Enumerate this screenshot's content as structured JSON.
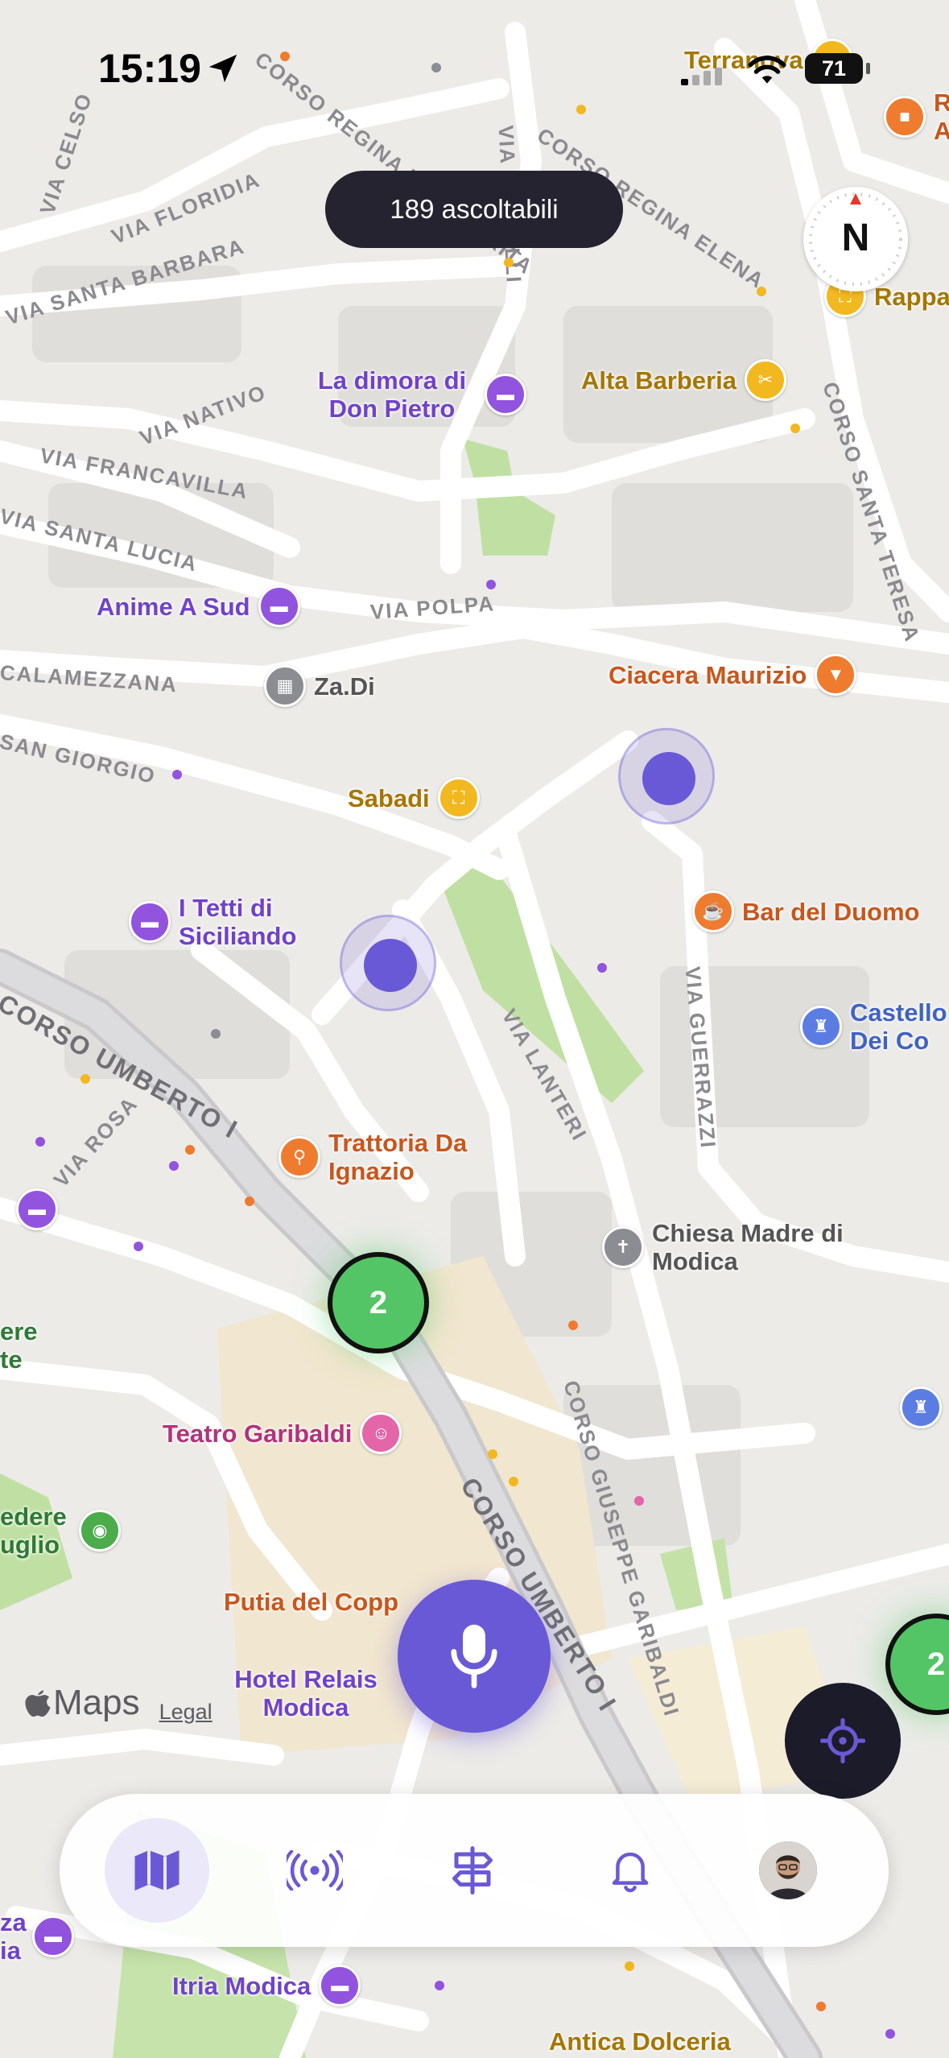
{
  "status_bar": {
    "time": "15:19",
    "battery": "71"
  },
  "listenable_pill": "189 ascoltabili",
  "compass_label": "N",
  "streets": [
    "Via Celso",
    "Via Floridia",
    "Via Santa Barbara",
    "Corso Regina Margherita",
    "Via Fratelli",
    "Corso Regina Elena",
    "Via Nativo",
    "Via Francavilla",
    "Via Santa Lucia",
    "Via Polpa",
    "Calamezzana",
    "San Giorgio",
    "Corso Santa Teresa",
    "Corso Umberto I",
    "Via Rosa",
    "Via Lanteri",
    "Via Guerrazzi",
    "Corso Giuseppe Garibaldi",
    "Corso Umberto I"
  ],
  "pois": [
    {
      "name": "Terranova",
      "kind": "yellow",
      "icon": "bag-icon"
    },
    {
      "name": "R A",
      "kind": "orange",
      "icon": "bag-icon"
    },
    {
      "name": "Rappa",
      "kind": "yellow",
      "icon": "basket-icon"
    },
    {
      "name": "La dimora di Don Pietro",
      "kind": "purple",
      "icon": "bed-icon"
    },
    {
      "name": "Alta Barberia",
      "kind": "yellow",
      "icon": "scissors-icon"
    },
    {
      "name": "Anime A Sud",
      "kind": "purple",
      "icon": "bed-icon"
    },
    {
      "name": "Za.Di",
      "kind": "gray",
      "icon": "building-icon"
    },
    {
      "name": "Ciacera Maurizio",
      "kind": "orange",
      "icon": "cocktail-icon"
    },
    {
      "name": "Sabadi",
      "kind": "yellow",
      "icon": "basket-icon"
    },
    {
      "name": "Bar del Duomo",
      "kind": "orange",
      "icon": "cup-icon"
    },
    {
      "name": "I Tetti di Siciliando",
      "kind": "purple",
      "icon": "bed-icon"
    },
    {
      "name": "Castello Dei Co",
      "kind": "blue",
      "icon": "castle-icon"
    },
    {
      "name": "Trattoria Da Ignazio",
      "kind": "orange",
      "icon": "fork-knife-icon"
    },
    {
      "name": "Chiesa Madre di Modica",
      "kind": "gray",
      "icon": "church-icon"
    },
    {
      "name": "ere te",
      "kind": "green",
      "icon": "park-icon"
    },
    {
      "name": "Teatro Garibaldi",
      "kind": "pink",
      "icon": "theater-icon"
    },
    {
      "name": "edere uglio",
      "kind": "green",
      "icon": "binoculars-icon"
    },
    {
      "name": "Putia del Copp",
      "kind": "orange",
      "icon": "fork-knife-icon"
    },
    {
      "name": "Hotel Relais Modica",
      "kind": "purple",
      "icon": "bed-icon"
    },
    {
      "name": "Itria Modica",
      "kind": "purple",
      "icon": "bed-icon"
    },
    {
      "name": "za ia",
      "kind": "purple",
      "icon": "bed-icon"
    },
    {
      "name": "Antica Dolceria",
      "kind": "yellow",
      "icon": "cake-icon"
    }
  ],
  "clusters": [
    "2",
    "2"
  ],
  "attribution": {
    "maps": "Maps",
    "legal": "Legal"
  },
  "tabbar": {
    "tabs": [
      {
        "name": "map",
        "active": true
      },
      {
        "name": "broadcast",
        "active": false
      },
      {
        "name": "directions",
        "active": false
      },
      {
        "name": "notifications",
        "active": false
      },
      {
        "name": "profile",
        "active": false
      }
    ]
  },
  "colors": {
    "accent": "#6a59d6",
    "pill_bg": "#252330",
    "cluster": "#54c566",
    "locate_bg": "#1c1b29"
  }
}
